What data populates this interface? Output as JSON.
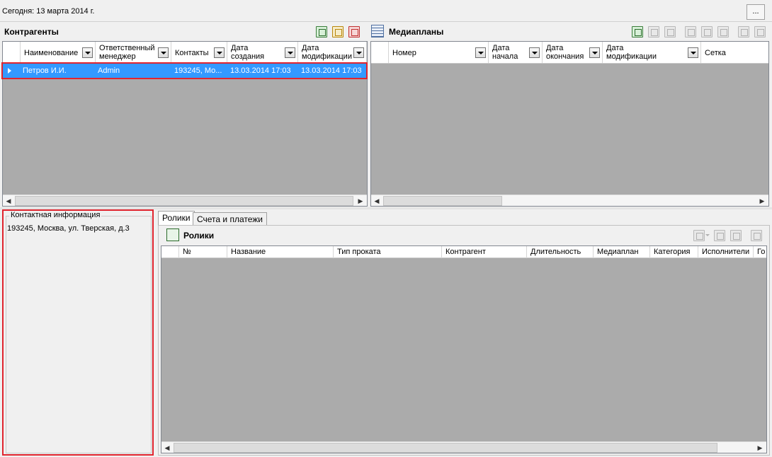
{
  "header": {
    "today": "Сегодня: 13 марта 2014 г.",
    "more_button": "..."
  },
  "contractors": {
    "title": "Контрагенты",
    "columns": [
      {
        "line1": "Наименование",
        "line2": ""
      },
      {
        "line1": "Ответственный",
        "line2": "менеджер"
      },
      {
        "line1": "Контакты",
        "line2": ""
      },
      {
        "line1": "Дата",
        "line2": "создания"
      },
      {
        "line1": "Дата",
        "line2": "модификации"
      }
    ],
    "rows": [
      {
        "name": "Петров И.И.",
        "manager": "Admin",
        "contacts": "193245, Мо...",
        "created": "13.03.2014 17:03",
        "modified": "13.03.2014 17:03"
      }
    ]
  },
  "mediaplans": {
    "title": "Медиапланы",
    "columns": [
      {
        "line1": "Номер",
        "line2": ""
      },
      {
        "line1": "Дата",
        "line2": "начала"
      },
      {
        "line1": "Дата",
        "line2": "окончания"
      },
      {
        "line1": "Дата",
        "line2": "модификации"
      },
      {
        "line1": "Сетка",
        "line2": ""
      }
    ]
  },
  "contact_info": {
    "title": "Контактная информация",
    "text": "193245, Москва, ул. Тверская, д.3"
  },
  "tabs": [
    "Ролики",
    "Счета и платежи"
  ],
  "clips": {
    "title": "Ролики",
    "columns": [
      "№",
      "Название",
      "Тип проката",
      "Контрагент",
      "Длительность",
      "Медиаплан",
      "Категория",
      "Исполнители",
      "Го"
    ]
  },
  "colors": {
    "selection": "#3399ff",
    "highlight": "#e0242e",
    "grid_bg": "#ababab"
  },
  "icons": [
    "add-icon",
    "edit-icon",
    "delete-icon",
    "list-icon",
    "clip-icon"
  ]
}
